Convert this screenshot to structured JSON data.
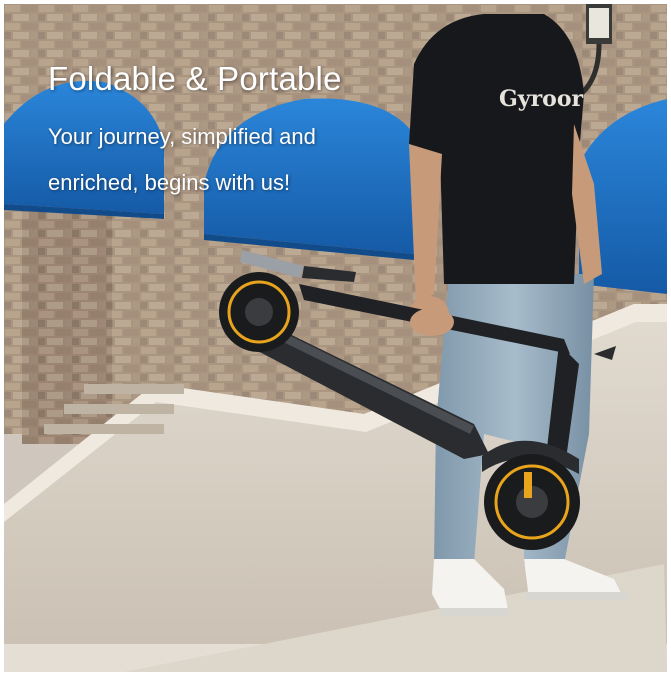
{
  "banner": {
    "title": "Foldable & Portable",
    "subtitle_line1": "Your journey, simplified and",
    "subtitle_line2": "enriched, begins with us!"
  },
  "shirt_print": "Gyroor",
  "colors": {
    "awning": "#1e74c8",
    "scooter": "#2a2c2f",
    "accent": "#e7a41c",
    "jeans": "#8fa6b8",
    "shirt": "#17181c",
    "wall": "#d6cec2"
  }
}
